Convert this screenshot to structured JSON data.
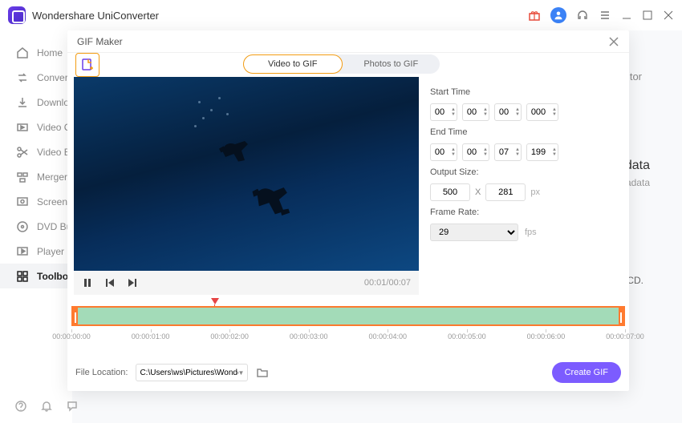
{
  "app": {
    "title": "Wondershare UniConverter"
  },
  "sidebar": {
    "items": [
      {
        "label": "Home"
      },
      {
        "label": "Converter"
      },
      {
        "label": "Downloader"
      },
      {
        "label": "Video Compressor"
      },
      {
        "label": "Video Editor"
      },
      {
        "label": "Merger"
      },
      {
        "label": "Screen Recorder"
      },
      {
        "label": "DVD Burner"
      },
      {
        "label": "Player"
      },
      {
        "label": "Toolbox"
      }
    ]
  },
  "backdrop": {
    "hint": "tor",
    "data_hdr": "data",
    "data_sub": "etadata",
    "cd": "CD."
  },
  "modal": {
    "title": "GIF Maker",
    "tabs": {
      "video": "Video to GIF",
      "photos": "Photos to GIF"
    },
    "playback": {
      "time": "00:01/00:07"
    },
    "settings": {
      "start_label": "Start Time",
      "start": {
        "h": "00",
        "m": "00",
        "s": "00",
        "ms": "000"
      },
      "end_label": "End Time",
      "end": {
        "h": "00",
        "m": "00",
        "s": "07",
        "ms": "199"
      },
      "output_label": "Output Size:",
      "output": {
        "w": "500",
        "h": "281",
        "x": "X",
        "unit": "px"
      },
      "fr_label": "Frame Rate:",
      "fr_value": "29",
      "fr_unit": "fps"
    },
    "timeline": {
      "ticks": [
        "00:00:00:00",
        "00:00:01:00",
        "00:00:02:00",
        "00:00:03:00",
        "00:00:04:00",
        "00:00:05:00",
        "00:00:06:00",
        "00:00:07:00"
      ]
    },
    "footer": {
      "label": "File Location:",
      "path": "C:\\Users\\ws\\Pictures\\Wonders",
      "create": "Create GIF"
    }
  }
}
